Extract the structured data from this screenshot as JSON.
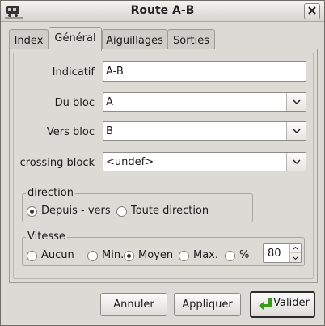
{
  "window": {
    "title": "Route A-B"
  },
  "tabs": [
    {
      "label": "Index",
      "active": false
    },
    {
      "label": "Général",
      "active": true
    },
    {
      "label": "Aiguillages",
      "active": false
    },
    {
      "label": "Sorties",
      "active": false
    }
  ],
  "form": {
    "indicatif": {
      "label": "Indicatif",
      "value": "A-B"
    },
    "du_bloc": {
      "label": "Du bloc",
      "value": "A"
    },
    "vers_bloc": {
      "label": "Vers bloc",
      "value": "B"
    },
    "crossing_block": {
      "label": "crossing block",
      "value": "<undef>"
    }
  },
  "direction": {
    "title": "direction",
    "options": [
      {
        "label": "Depuis - vers",
        "selected": true
      },
      {
        "label": "Toute direction",
        "selected": false
      }
    ]
  },
  "vitesse": {
    "title": "Vitesse",
    "options": [
      {
        "label": "Aucun",
        "selected": false
      },
      {
        "label": "Min.",
        "selected": false
      },
      {
        "label": "Moyen",
        "selected": true
      },
      {
        "label": "Max.",
        "selected": false
      },
      {
        "label": "%",
        "selected": false
      }
    ],
    "percent_value": "80"
  },
  "buttons": {
    "annuler": "Annuler",
    "appliquer": "Appliquer",
    "valider_first": "V",
    "valider_rest": "alider"
  },
  "colors": {
    "valider_icon": "#3c9a1e"
  },
  "icons": {
    "window": "train-icon",
    "close": "close-icon",
    "valider": "enter-arrow-icon"
  }
}
